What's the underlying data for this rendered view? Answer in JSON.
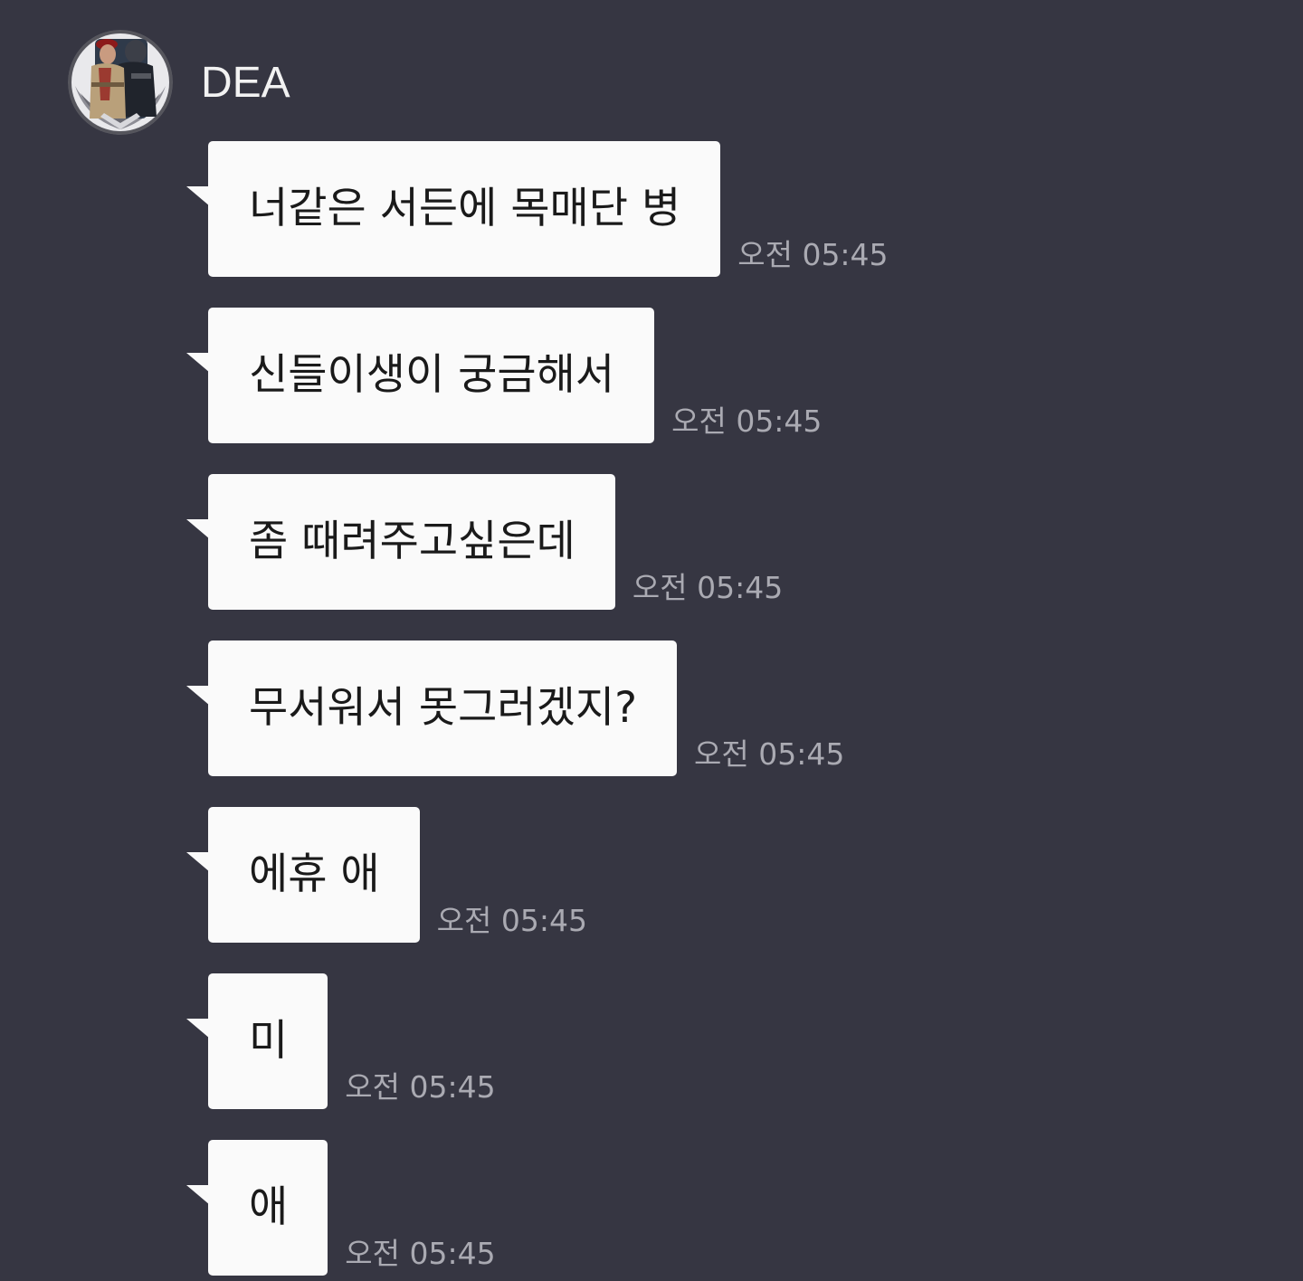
{
  "sender": {
    "name": "DEA",
    "avatar_icon": "profile-avatar-soldiers-emblem"
  },
  "messages": [
    {
      "text": "너같은 서든에 목매단 병",
      "time": "오전 05:45"
    },
    {
      "text": "신들이생이 궁금해서",
      "time": "오전 05:45"
    },
    {
      "text": "좀 때려주고싶은데",
      "time": "오전 05:45"
    },
    {
      "text": "무서워서 못그러겠지?",
      "time": "오전 05:45"
    },
    {
      "text": "에휴 애",
      "time": "오전 05:45"
    },
    {
      "text": "미",
      "time": "오전 05:45"
    },
    {
      "text": "애",
      "time": "오전 05:45"
    }
  ],
  "colors": {
    "background": "#363642",
    "bubble": "#fafafa",
    "bubble_text": "#1a1a1a",
    "time_text": "#aaaab2",
    "name_text": "#f2f2f2"
  }
}
